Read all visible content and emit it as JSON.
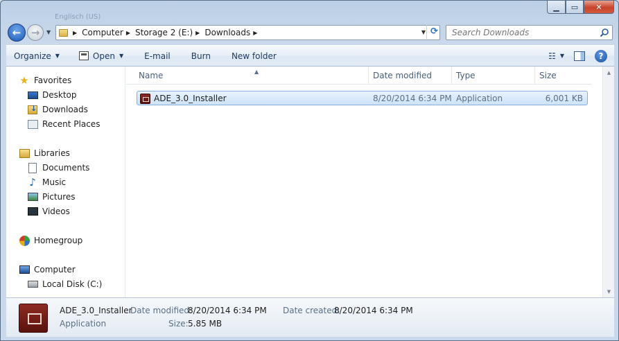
{
  "window": {
    "title_ghost": "Englisch (US)"
  },
  "address": {
    "crumbs": [
      "Computer",
      "Storage 2 (E:)",
      "Downloads"
    ],
    "search_placeholder": "Search Downloads"
  },
  "toolbar": {
    "organize": "Organize",
    "open": "Open",
    "email": "E-mail",
    "burn": "Burn",
    "new_folder": "New folder"
  },
  "nav": {
    "favorites": "Favorites",
    "desktop": "Desktop",
    "downloads": "Downloads",
    "recent_places": "Recent Places",
    "libraries": "Libraries",
    "documents": "Documents",
    "music": "Music",
    "pictures": "Pictures",
    "videos": "Videos",
    "homegroup": "Homegroup",
    "computer": "Computer",
    "local_disk": "Local Disk (C:)"
  },
  "columns": {
    "name": "Name",
    "date": "Date modified",
    "type": "Type",
    "size": "Size"
  },
  "files": [
    {
      "name": "ADE_3.0_Installer",
      "date": "8/20/2014 6:34 PM",
      "type": "Application",
      "size": "6,001 KB"
    }
  ],
  "details": {
    "name": "ADE_3.0_Installer",
    "type": "Application",
    "date_modified_label": "Date modified:",
    "date_modified": "8/20/2014 6:34 PM",
    "size_label": "Size:",
    "size": "5.85 MB",
    "date_created_label": "Date created:",
    "date_created": "8/20/2014 6:34 PM"
  },
  "icons": [
    "back-icon",
    "forward-icon",
    "folder-icon",
    "refresh-icon",
    "search-icon",
    "views-icon",
    "preview-pane-icon",
    "help-icon",
    "star-icon",
    "application-icon"
  ]
}
